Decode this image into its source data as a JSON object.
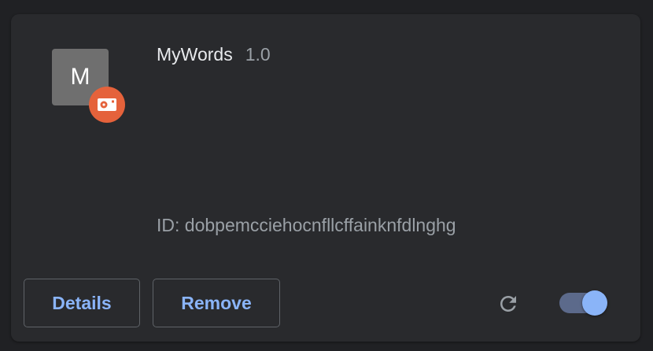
{
  "extension": {
    "icon_letter": "M",
    "badge_icon": "unpacked-source-icon",
    "name": "MyWords",
    "version": "1.0",
    "id_text": "ID: dobpemcciehocnfllcffainknfdlnghg",
    "enabled": true
  },
  "actions": {
    "details_label": "Details",
    "remove_label": "Remove",
    "reload_icon": "reload-icon",
    "toggle_icon": "enable-toggle"
  },
  "colors": {
    "background": "#202124",
    "card": "#292a2d",
    "accent": "#8ab4f8",
    "badge": "#e5623b",
    "icon_bg": "#6f6f6f"
  }
}
